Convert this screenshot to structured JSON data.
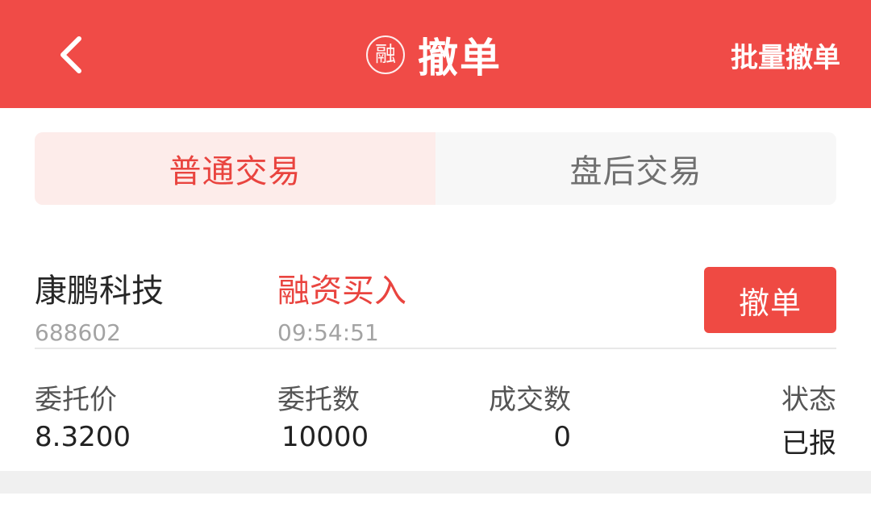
{
  "header": {
    "title": "撤单",
    "logo_char": "融",
    "batch_label": "批量撤单",
    "bg_color": "#f04b47"
  },
  "tabs": [
    {
      "label": "普通交易",
      "active": true
    },
    {
      "label": "盘后交易",
      "active": false
    }
  ],
  "order": {
    "stock_name": "康鹏科技",
    "stock_code": "688602",
    "type": "融资买入",
    "time": "09:54:51",
    "cancel_label": "撤单",
    "fields": {
      "price_label": "委托价",
      "price_value": "8.3200",
      "qty_label": "委托数",
      "qty_value": "10000",
      "filled_label": "成交数",
      "filled_value": "0",
      "status_label": "状态",
      "status_value": "已报"
    }
  },
  "colors": {
    "accent": "#e9443f",
    "tab_active_bg": "#fdecea",
    "tab_inactive_bg": "#f7f7f7"
  },
  "icons": {
    "back": "chevron-left-icon",
    "logo": "margin-trading-seal-icon"
  }
}
